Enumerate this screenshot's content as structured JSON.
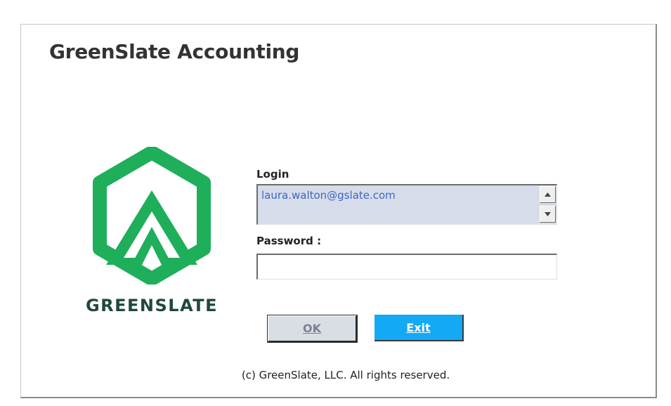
{
  "window": {
    "title": "GreenSlate Accounting"
  },
  "logo": {
    "icon": "greenslate-hexagon-logo-icon",
    "wordmark": "GREENSLATE",
    "brand_color": "#1fae5a",
    "wordmark_color": "#1f4a38"
  },
  "form": {
    "login_label": "Login",
    "login_value": "laura.walton@gslate.com",
    "password_label": "Password :",
    "password_value": ""
  },
  "buttons": {
    "ok_label": "OK",
    "exit_label": "Exit",
    "exit_color": "#14a9f4"
  },
  "footer": {
    "copyright": "(c) GreenSlate, LLC. All rights reserved."
  }
}
